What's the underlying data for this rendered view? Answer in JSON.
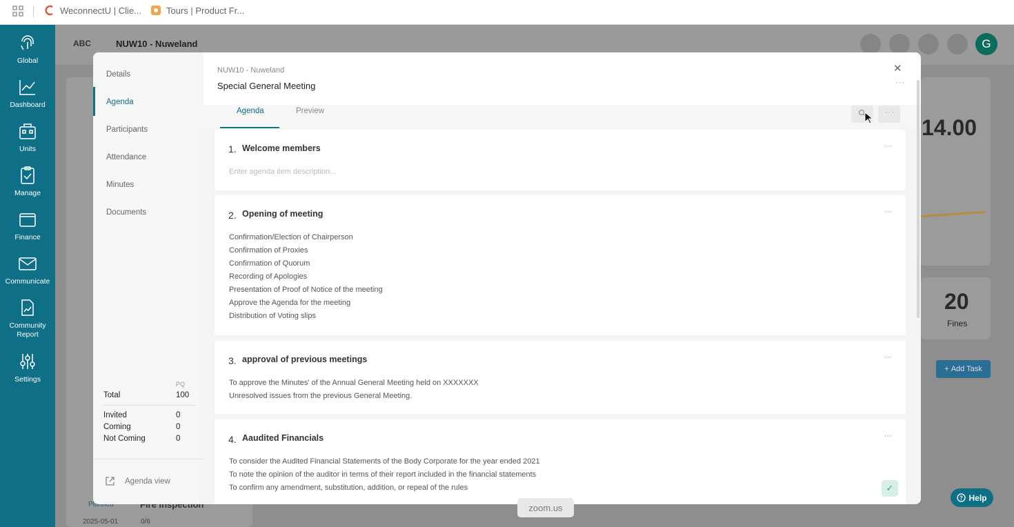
{
  "browser_tabs": [
    {
      "label": "WeconnectU | Clie...",
      "icon": "weconnectu-logo-icon"
    },
    {
      "label": "Tours | Product Fr...",
      "icon": "tours-logo-icon"
    }
  ],
  "sidebar": {
    "items": [
      {
        "label": "Global",
        "icon": "fingerprint-icon"
      },
      {
        "label": "Dashboard",
        "icon": "chart-line-icon"
      },
      {
        "label": "Units",
        "icon": "building-icon"
      },
      {
        "label": "Manage",
        "icon": "clipboard-check-icon"
      },
      {
        "label": "Finance",
        "icon": "wallet-icon"
      },
      {
        "label": "Communicate",
        "icon": "mail-icon"
      },
      {
        "label": "Community Report",
        "icon": "report-icon"
      },
      {
        "label": "Settings",
        "icon": "sliders-icon"
      }
    ]
  },
  "app_header": {
    "logo": "ABC",
    "title": "NUW10 - Nuweland",
    "avatar_initial": "G"
  },
  "background": {
    "big_number": "14.00",
    "fines_count": "20",
    "fines_label": "Fines",
    "add_task_label": "Add Task",
    "task_status": "Planned",
    "task_title": "Fire Inspection",
    "task_date": "2025-05-01",
    "task_progress": "0/6"
  },
  "modal": {
    "breadcrumb": "NUW10 - Nuweland",
    "title": "Special General Meeting",
    "nav": [
      "Details",
      "Agenda",
      "Participants",
      "Attendance",
      "Minutes",
      "Documents"
    ],
    "active_nav": "Agenda",
    "stats": {
      "column_header": "PQ",
      "total_label": "Total",
      "total_value": "100",
      "rows": [
        {
          "label": "Invited",
          "value": "0"
        },
        {
          "label": "Coming",
          "value": "0"
        },
        {
          "label": "Not Coming",
          "value": "0"
        }
      ]
    },
    "agenda_view_label": "Agenda view",
    "tabs": [
      "Agenda",
      "Preview"
    ],
    "active_tab": "Agenda"
  },
  "agenda": [
    {
      "number": "1.",
      "title": "Welcome members",
      "placeholder": "Enter agenda item description...",
      "lines": []
    },
    {
      "number": "2.",
      "title": "Opening of meeting",
      "lines": [
        "Confirmation/Election of Chairperson",
        "Confirmation of Proxies",
        "Confirmation of Quorum",
        "Recording of Apologies",
        "Presentation of Proof of Notice of the meeting",
        "Approve the Agenda for the meeting",
        "Distribution of Voting slips"
      ]
    },
    {
      "number": "3.",
      "title": "approval of previous meetings",
      "lines": [
        "To approve the Minutes' of the Annual General Meeting held on XXXXXXX",
        "Unresolved issues from the previous General Meeting."
      ]
    },
    {
      "number": "4.",
      "title": "Aaudited Financials",
      "lines": [
        "To consider the Audited Financial Statements of the Body Corporate for the year ended 2021",
        "To note the opinion of the auditor in terms of their report included in the financial statements",
        "To confirm any amendment, substitution, addition, or repeal of the rules"
      ]
    }
  ],
  "overlays": {
    "zoom_label": "zoom.us",
    "help_label": "Help"
  },
  "colors": {
    "brand": "#0e6f86",
    "overlay_gray": "#8e8e8e",
    "check_green": "#3aa27b"
  }
}
